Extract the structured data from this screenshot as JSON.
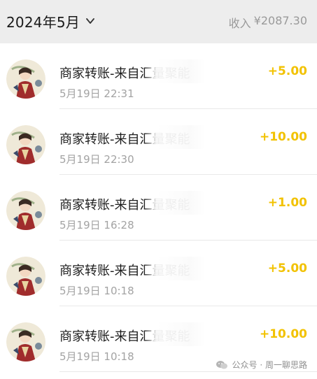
{
  "header": {
    "month": "2024年5月",
    "income_label": "收入",
    "income_amount": "¥2087.30"
  },
  "transactions": [
    {
      "title": "商家转账-来自汇量聚能",
      "time": "5月19日 22:31",
      "amount": "+5.00"
    },
    {
      "title": "商家转账-来自汇量聚能",
      "time": "5月19日 22:30",
      "amount": "+10.00"
    },
    {
      "title": "商家转账-来自汇量聚能",
      "time": "5月19日 16:28",
      "amount": "+1.00"
    },
    {
      "title": "商家转账-来自汇量聚能",
      "time": "5月19日 10:18",
      "amount": "+5.00"
    },
    {
      "title": "商家转账-来自汇量聚能",
      "time": "5月19日 10:18",
      "amount": "+10.00"
    }
  ],
  "watermark": {
    "text": "公众号 · 周一聊思路"
  },
  "colors": {
    "header_bg": "#ededed",
    "amount": "#f2c200",
    "secondary_text": "#a3a3a3"
  }
}
